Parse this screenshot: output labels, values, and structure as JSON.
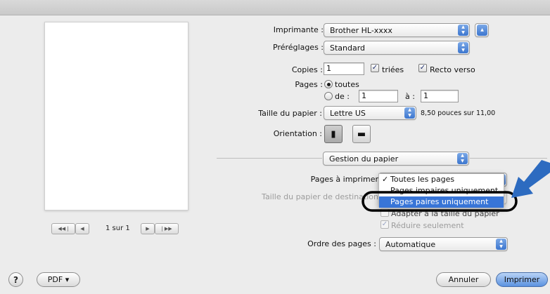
{
  "preview": {
    "first_page_icon": "first-page-icon",
    "prev_page_icon": "prev-page-icon",
    "next_page_icon": "next-page-icon",
    "last_page_icon": "last-page-icon",
    "page_counter": "1 sur 1"
  },
  "printer": {
    "label": "Imprimante :",
    "value": "Brother HL-xxxx"
  },
  "presets": {
    "label": "Préréglages :",
    "value": "Standard"
  },
  "copies": {
    "label": "Copies :",
    "value": "1",
    "collated_label": "triées",
    "collated_checked": true,
    "duplex_label": "Recto verso",
    "duplex_checked": true
  },
  "pages": {
    "label": "Pages :",
    "all_label": "toutes",
    "all_selected": true,
    "from_label": "de :",
    "from_value": "1",
    "to_label": "à :",
    "to_value": "1"
  },
  "paper_size": {
    "label": "Taille du papier :",
    "value": "Lettre US",
    "dimensions": "8,50 pouces sur 11,00"
  },
  "orientation": {
    "label": "Orientation :",
    "portrait_icon": "portrait-orientation-icon",
    "landscape_icon": "landscape-orientation-icon",
    "selected": "portrait"
  },
  "section": {
    "value": "Gestion du papier"
  },
  "pages_to_print": {
    "label": "Pages à imprimer",
    "menu_items": [
      {
        "label": "Toutes les pages",
        "checked": true
      },
      {
        "label": "Pages impaires uniquement"
      },
      {
        "label": "Pages paires uniquement",
        "highlighted": true
      }
    ]
  },
  "destination_paper_size": {
    "label": "Taille du papier de destination",
    "fit_label": "Adapter à la taille du papier",
    "scale_down_label": "Réduire seulement",
    "scale_down_checked": true
  },
  "page_order": {
    "label": "Ordre des pages :",
    "value": "Automatique"
  },
  "footer": {
    "help_label": "?",
    "pdf_label": "PDF ▾",
    "cancel_label": "Annuler",
    "print_label": "Imprimer"
  },
  "annotation": {
    "arrow_color": "#2d6bc0",
    "highlight_color": "#000000"
  }
}
